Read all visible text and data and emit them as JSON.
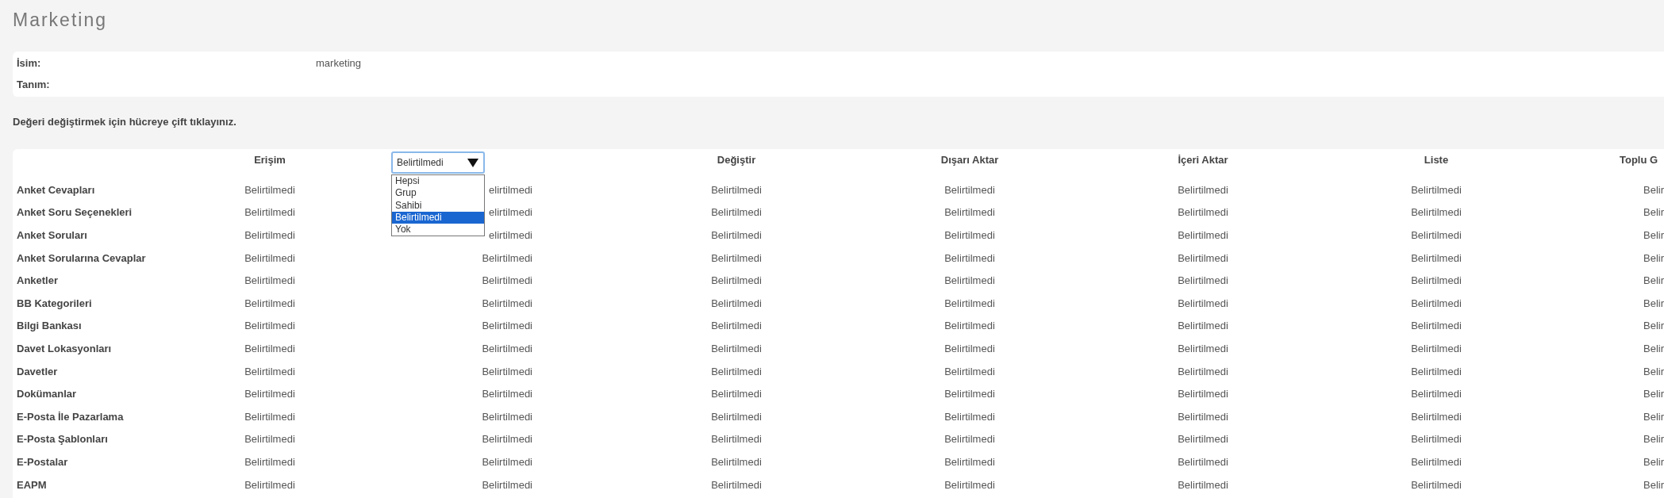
{
  "page": {
    "title": "Marketing"
  },
  "details": [
    {
      "label": "İsim:",
      "value": "marketing"
    },
    {
      "label": "Tanım:"
    }
  ],
  "hint": "Değeri değiştirmek için hücreye çift tıklayınız.",
  "table": {
    "columns": [
      {
        "kind": "text",
        "label": "Erişim"
      },
      {
        "kind": "select",
        "value": "Belirtilmedi",
        "expanded": true,
        "options": [
          {
            "label": "Hepsi",
            "selected": false
          },
          {
            "label": "Grup",
            "selected": false
          },
          {
            "label": "Sahibi",
            "selected": false
          },
          {
            "label": "Belirtilmedi",
            "selected": true
          },
          {
            "label": "Yok",
            "selected": false
          }
        ]
      },
      {
        "kind": "text",
        "label": "Değiştir"
      },
      {
        "kind": "text",
        "label": "Dışarı Aktar"
      },
      {
        "kind": "text",
        "label": "İçeri Aktar"
      },
      {
        "kind": "text",
        "label": "Liste"
      },
      {
        "kind": "text",
        "label": "Toplu G"
      }
    ],
    "rows": [
      {
        "name": "Anket Cevapları",
        "cells": [
          "Belirtilmedi",
          "elirtilmedi",
          "Belirtilmedi",
          "Belirtilmedi",
          "Belirtilmedi",
          "Belirtilmedi",
          "Belir"
        ]
      },
      {
        "name": "Anket Soru Seçenekleri",
        "cells": [
          "Belirtilmedi",
          "elirtilmedi",
          "Belirtilmedi",
          "Belirtilmedi",
          "Belirtilmedi",
          "Belirtilmedi",
          "Belir"
        ]
      },
      {
        "name": "Anket Soruları",
        "cells": [
          "Belirtilmedi",
          "elirtilmedi",
          "Belirtilmedi",
          "Belirtilmedi",
          "Belirtilmedi",
          "Belirtilmedi",
          "Belir"
        ]
      },
      {
        "name": "Anket Sorularına Cevaplar",
        "cells": [
          "Belirtilmedi",
          "Belirtilmedi",
          "Belirtilmedi",
          "Belirtilmedi",
          "Belirtilmedi",
          "Belirtilmedi",
          "Belir"
        ]
      },
      {
        "name": "Anketler",
        "cells": [
          "Belirtilmedi",
          "Belirtilmedi",
          "Belirtilmedi",
          "Belirtilmedi",
          "Belirtilmedi",
          "Belirtilmedi",
          "Belir"
        ]
      },
      {
        "name": "BB Kategorileri",
        "cells": [
          "Belirtilmedi",
          "Belirtilmedi",
          "Belirtilmedi",
          "Belirtilmedi",
          "Belirtilmedi",
          "Belirtilmedi",
          "Belir"
        ]
      },
      {
        "name": "Bilgi Bankası",
        "cells": [
          "Belirtilmedi",
          "Belirtilmedi",
          "Belirtilmedi",
          "Belirtilmedi",
          "Belirtilmedi",
          "Belirtilmedi",
          "Belir"
        ]
      },
      {
        "name": "Davet Lokasyonları",
        "cells": [
          "Belirtilmedi",
          "Belirtilmedi",
          "Belirtilmedi",
          "Belirtilmedi",
          "Belirtilmedi",
          "Belirtilmedi",
          "Belir"
        ]
      },
      {
        "name": "Davetler",
        "cells": [
          "Belirtilmedi",
          "Belirtilmedi",
          "Belirtilmedi",
          "Belirtilmedi",
          "Belirtilmedi",
          "Belirtilmedi",
          "Belir"
        ]
      },
      {
        "name": "Dokümanlar",
        "cells": [
          "Belirtilmedi",
          "Belirtilmedi",
          "Belirtilmedi",
          "Belirtilmedi",
          "Belirtilmedi",
          "Belirtilmedi",
          "Belir"
        ]
      },
      {
        "name": "E-Posta İle Pazarlama",
        "cells": [
          "Belirtilmedi",
          "Belirtilmedi",
          "Belirtilmedi",
          "Belirtilmedi",
          "Belirtilmedi",
          "Belirtilmedi",
          "Belir"
        ]
      },
      {
        "name": "E-Posta Şablonları",
        "cells": [
          "Belirtilmedi",
          "Belirtilmedi",
          "Belirtilmedi",
          "Belirtilmedi",
          "Belirtilmedi",
          "Belirtilmedi",
          "Belir"
        ]
      },
      {
        "name": "E-Postalar",
        "cells": [
          "Belirtilmedi",
          "Belirtilmedi",
          "Belirtilmedi",
          "Belirtilmedi",
          "Belirtilmedi",
          "Belirtilmedi",
          "Belir"
        ]
      },
      {
        "name": "EAPM",
        "cells": [
          "Belirtilmedi",
          "Belirtilmedi",
          "Belirtilmedi",
          "Belirtilmedi",
          "Belirtilmedi",
          "Belirtilmedi",
          "Belir"
        ]
      }
    ]
  }
}
